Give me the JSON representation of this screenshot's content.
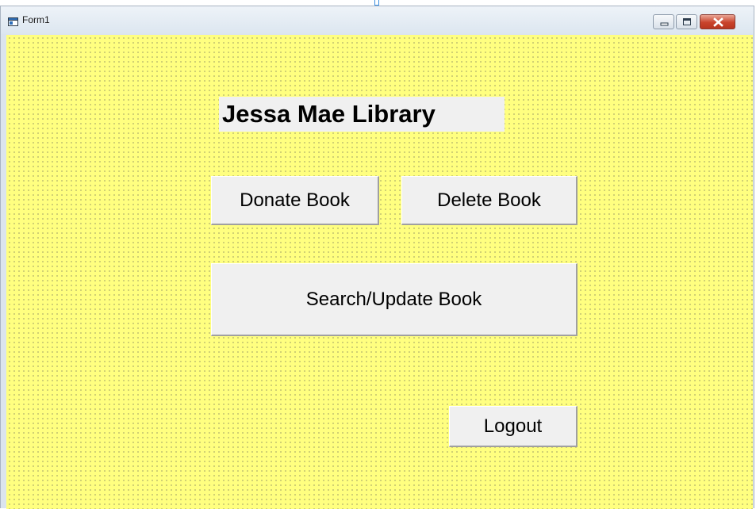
{
  "window": {
    "title": "Form1",
    "controls": {
      "minimize_icon": "minimize-icon",
      "maximize_icon": "maximize-icon",
      "close_icon": "close-icon"
    }
  },
  "form": {
    "background_color": "#ffff80",
    "title_label": "Jessa Mae Library",
    "buttons": {
      "donate": "Donate Book",
      "delete": "Delete Book",
      "search_update": "Search/Update Book",
      "logout": "Logout"
    }
  }
}
